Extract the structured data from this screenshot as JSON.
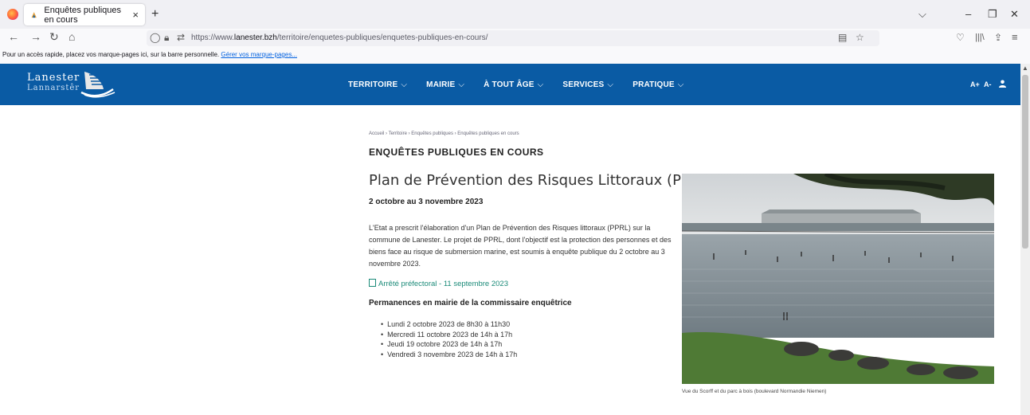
{
  "browser": {
    "tab_title": "Enquêtes publiques en cours",
    "url_prefix": "https://www.",
    "url_domain": "lanester.bzh",
    "url_path": "/territoire/enquetes-publiques/enquetes-publiques-en-cours/",
    "bookmarks_hint": "Pour un accès rapide, placez vos marque-pages ici, sur la barre personnelle.",
    "bookmarks_link": "Gérer vos marque-pages..."
  },
  "site": {
    "logo_line1": "Lanester",
    "logo_line2": "Lannarstêr",
    "brand_color": "#0a5ba4",
    "nav": [
      {
        "label": "TERRITOIRE"
      },
      {
        "label": "MAIRIE"
      },
      {
        "label": "À TOUT ÂGE"
      },
      {
        "label": "SERVICES"
      },
      {
        "label": "PRATIQUE"
      }
    ],
    "font_plus": "A+",
    "font_minus": "A-"
  },
  "content": {
    "breadcrumb": "Accueil › Territoire › Enquêtes publiques › Enquêtes publiques en cours",
    "page_title": "ENQUÊTES PUBLIQUES EN COURS",
    "heading": "Plan de Prévention des Risques Littoraux (PPRL)",
    "dates": "2 octobre au 3 novembre 2023",
    "intro": "L'Etat a prescrit l'élaboration d'un Plan de Prévention des Risques littoraux (PPRL) sur la commune de Lanester. Le projet de PPRL, dont l'objectif est la protection des personnes et des biens face au risque de submersion marine, est soumis à enquête publique du 2 octobre au 3 novembre 2023.",
    "doc_link": "Arrêté préfectoral - 11 septembre 2023",
    "permanences_title": "Permanences en mairie de la commissaire enquêtrice",
    "permanences": [
      "Lundi 2 octobre 2023 de 8h30 à 11h30",
      "Mercredi 11 octobre 2023 de 14h à 17h",
      "Jeudi 19 octobre 2023 de 14h à 17h",
      "Vendredi 3 novembre 2023 de 14h à 17h"
    ],
    "photo_caption": "Vue du Scorff et du parc à bois (boulevard Normandie Niemen)"
  }
}
